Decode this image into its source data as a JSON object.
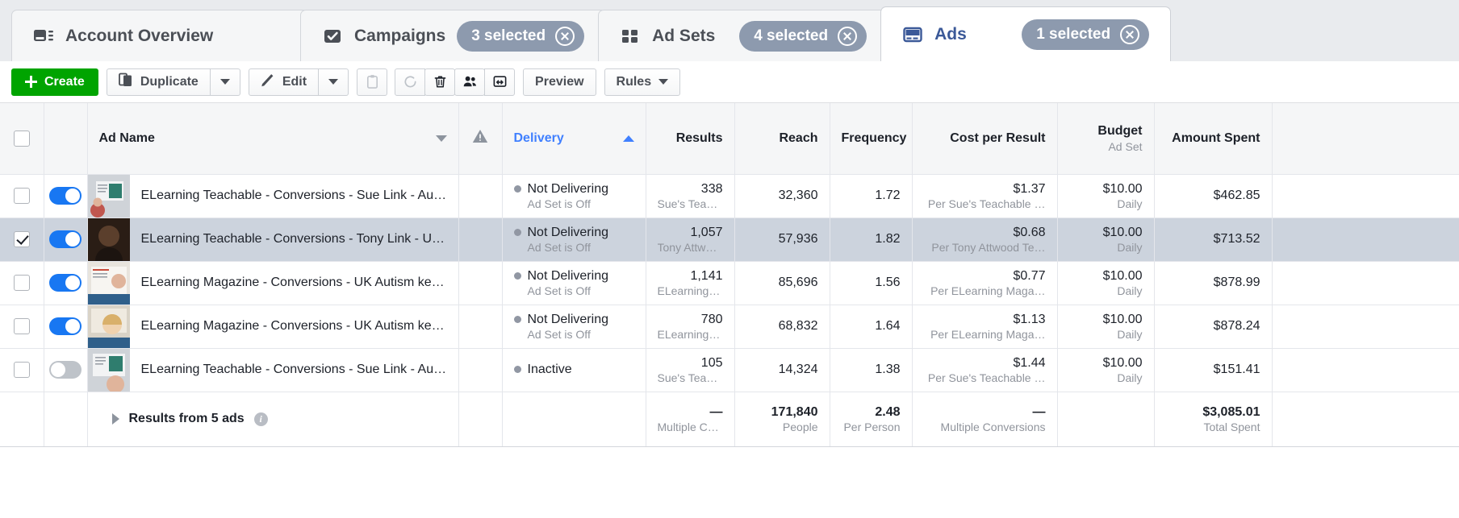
{
  "tabs": [
    {
      "id": "account-overview",
      "label": "Account Overview",
      "icon": "account-overview-icon",
      "active": false,
      "selected_badge": null
    },
    {
      "id": "campaigns",
      "label": "Campaigns",
      "icon": "campaigns-icon",
      "active": false,
      "selected_badge": "3 selected"
    },
    {
      "id": "ad-sets",
      "label": "Ad Sets",
      "icon": "ad-sets-icon",
      "active": false,
      "selected_badge": "4 selected"
    },
    {
      "id": "ads",
      "label": "Ads",
      "icon": "ads-icon",
      "active": true,
      "selected_badge": "1 selected"
    }
  ],
  "toolbar": {
    "create_label": "Create",
    "duplicate_label": "Duplicate",
    "edit_label": "Edit",
    "preview_label": "Preview",
    "rules_label": "Rules",
    "icons": [
      {
        "name": "clipboard-icon",
        "disabled": true
      },
      {
        "name": "refresh-icon",
        "disabled": true
      },
      {
        "name": "trash-icon",
        "disabled": false
      },
      {
        "name": "audience-icon",
        "disabled": false
      },
      {
        "name": "export-icon",
        "disabled": false
      }
    ]
  },
  "table": {
    "columns": [
      {
        "key": "check",
        "label": ""
      },
      {
        "key": "toggle",
        "label": ""
      },
      {
        "key": "name",
        "label": "Ad Name",
        "sort_icon": "chevron-down-icon"
      },
      {
        "key": "warn",
        "label": "",
        "icon": "warning-icon"
      },
      {
        "key": "delivery",
        "label": "Delivery",
        "sorted": true,
        "sort_icon": "triangle-up-icon"
      },
      {
        "key": "results",
        "label": "Results"
      },
      {
        "key": "reach",
        "label": "Reach"
      },
      {
        "key": "frequency",
        "label": "Frequency"
      },
      {
        "key": "cost_per_result",
        "label": "Cost per Result"
      },
      {
        "key": "budget",
        "label": "Budget",
        "sublabel": "Ad Set"
      },
      {
        "key": "amount_spent",
        "label": "Amount Spent"
      }
    ],
    "rows": [
      {
        "checked": false,
        "toggle_on": true,
        "name": "ELearning Teachable - Conversions - Sue Link - Autism Ke…",
        "delivery": "Not Delivering",
        "delivery_sub": "Ad Set is Off",
        "results": "338",
        "results_sub": "Sue's Teacha…",
        "reach": "32,360",
        "frequency": "1.72",
        "cost_per_result": "$1.37",
        "cost_per_result_sub": "Per Sue's Teachable …",
        "budget": "$10.00",
        "budget_sub": "Daily",
        "amount_spent": "$462.85"
      },
      {
        "checked": true,
        "toggle_on": true,
        "name": "ELearning Teachable - Conversions - Tony Link - UK Autis…",
        "delivery": "Not Delivering",
        "delivery_sub": "Ad Set is Off",
        "results": "1,057",
        "results_sub": "Tony Attwood…",
        "reach": "57,936",
        "frequency": "1.82",
        "cost_per_result": "$0.68",
        "cost_per_result_sub": "Per Tony Attwood Te…",
        "budget": "$10.00",
        "budget_sub": "Daily",
        "amount_spent": "$713.52"
      },
      {
        "checked": false,
        "toggle_on": true,
        "name": "ELearning Magazine - Conversions - UK Autism keywords …",
        "delivery": "Not Delivering",
        "delivery_sub": "Ad Set is Off",
        "results": "1,141",
        "results_sub": "ELearning M…",
        "reach": "85,696",
        "frequency": "1.56",
        "cost_per_result": "$0.77",
        "cost_per_result_sub": "Per ELearning Maga…",
        "budget": "$10.00",
        "budget_sub": "Daily",
        "amount_spent": "$878.99"
      },
      {
        "checked": false,
        "toggle_on": true,
        "name": "ELearning Magazine - Conversions - UK Autism keywords …",
        "delivery": "Not Delivering",
        "delivery_sub": "Ad Set is Off",
        "results": "780",
        "results_sub": "ELearning M…",
        "reach": "68,832",
        "frequency": "1.64",
        "cost_per_result": "$1.13",
        "cost_per_result_sub": "Per ELearning Maga…",
        "budget": "$10.00",
        "budget_sub": "Daily",
        "amount_spent": "$878.24"
      },
      {
        "checked": false,
        "toggle_on": false,
        "name": "ELearning Teachable - Conversions - Sue Link - Autism Ke…",
        "delivery": "Inactive",
        "delivery_sub": "",
        "results": "105",
        "results_sub": "Sue's Teacha…",
        "reach": "14,324",
        "frequency": "1.38",
        "cost_per_result": "$1.44",
        "cost_per_result_sub": "Per Sue's Teachable …",
        "budget": "$10.00",
        "budget_sub": "Daily",
        "amount_spent": "$151.41"
      }
    ],
    "summary": {
      "label": "Results from 5 ads",
      "results": "—",
      "results_sub": "Multiple Con…",
      "reach": "171,840",
      "reach_sub": "People",
      "frequency": "2.48",
      "frequency_sub": "Per Person",
      "cost_per_result": "—",
      "cost_per_result_sub": "Multiple Conversions",
      "budget": "",
      "budget_sub": "",
      "amount_spent": "$3,085.01",
      "amount_spent_sub": "Total Spent"
    }
  },
  "colors": {
    "accent_blue": "#3b5998",
    "link_blue": "#4080ff",
    "create_green": "#00a400",
    "pill_grey": "#8d9aae",
    "selected_row": "#ccd3dd"
  }
}
